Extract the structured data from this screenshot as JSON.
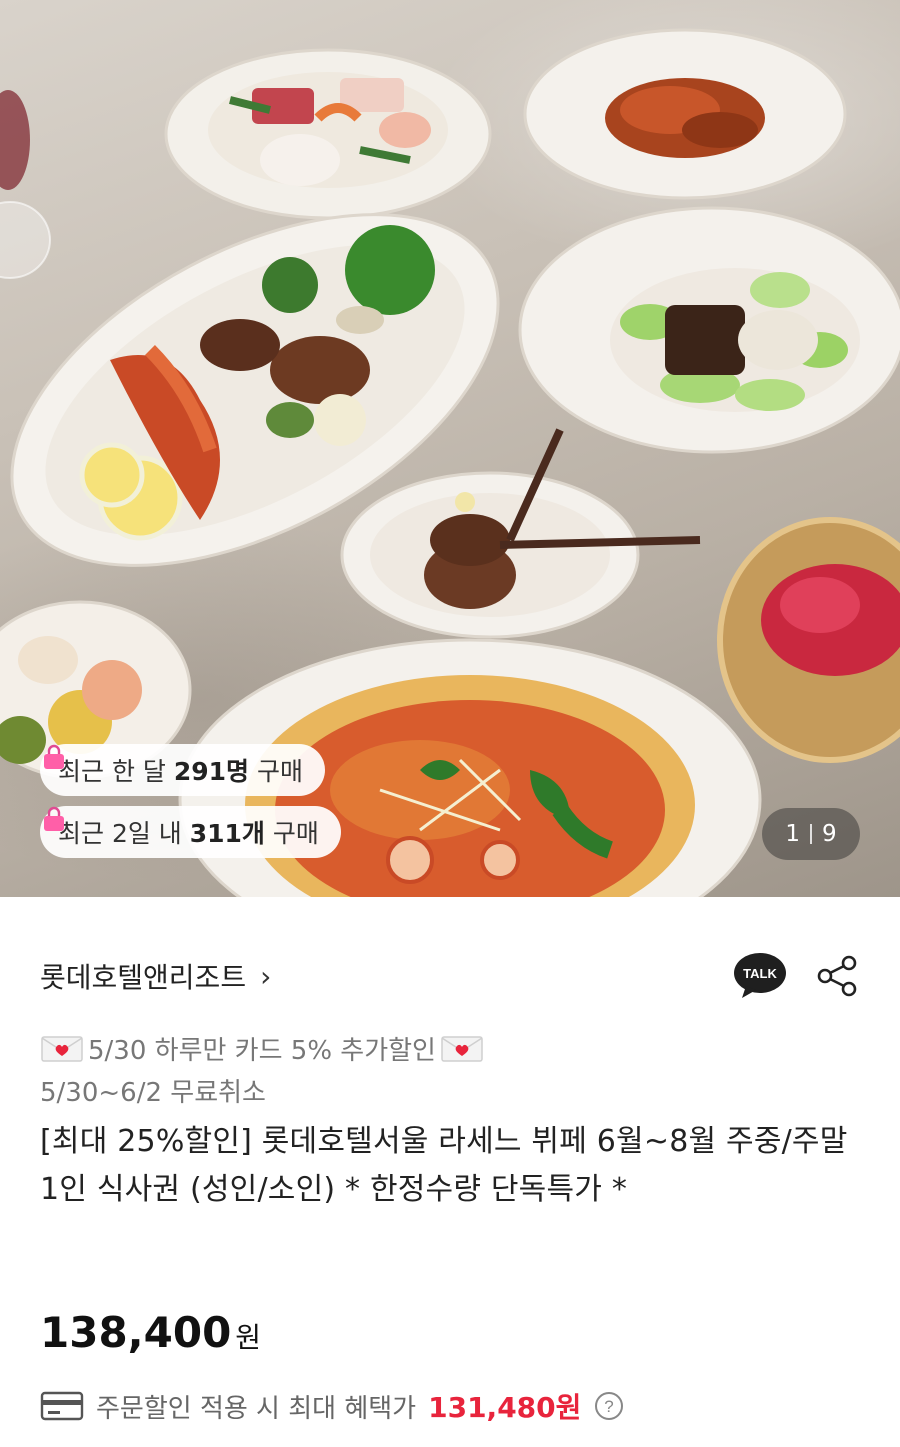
{
  "hero": {
    "badges": [
      {
        "prefix": "최근 한 달 ",
        "strong": "291명",
        "suffix": " 구매"
      },
      {
        "prefix": "최근 2일 내 ",
        "strong": "311개",
        "suffix": " 구매"
      }
    ],
    "counter": {
      "current": "1",
      "total": "9"
    }
  },
  "brand": {
    "name": "롯데호텔앤리조트",
    "chevron": "›"
  },
  "actions": {
    "talk_label": "TALK"
  },
  "promo": {
    "text": "5/30 하루만 카드 5% 추가할인"
  },
  "cancel": {
    "text": "5/30~6/2 무료취소"
  },
  "product": {
    "title": "[최대 25%할인] 롯데호텔서울 라세느 뷔페 6월~8월 주중/주말 1인 식사권 (성인/소인) * 한정수량 단독특가 *"
  },
  "price": {
    "amount": "138,400",
    "unit": "원"
  },
  "benefit": {
    "label": "주문할인 적용 시 최대 혜택가",
    "price": "131,480원"
  },
  "colors": {
    "accent": "#e8243c",
    "badge_bag": "#ff5fa8",
    "envelope_heart": "#e8243c"
  },
  "icons": {
    "bag": "shopping-bag-icon",
    "talk": "kakao-talk-icon",
    "share": "share-icon",
    "envelope": "love-letter-icon",
    "card": "credit-card-icon",
    "help": "question-circle-icon"
  }
}
